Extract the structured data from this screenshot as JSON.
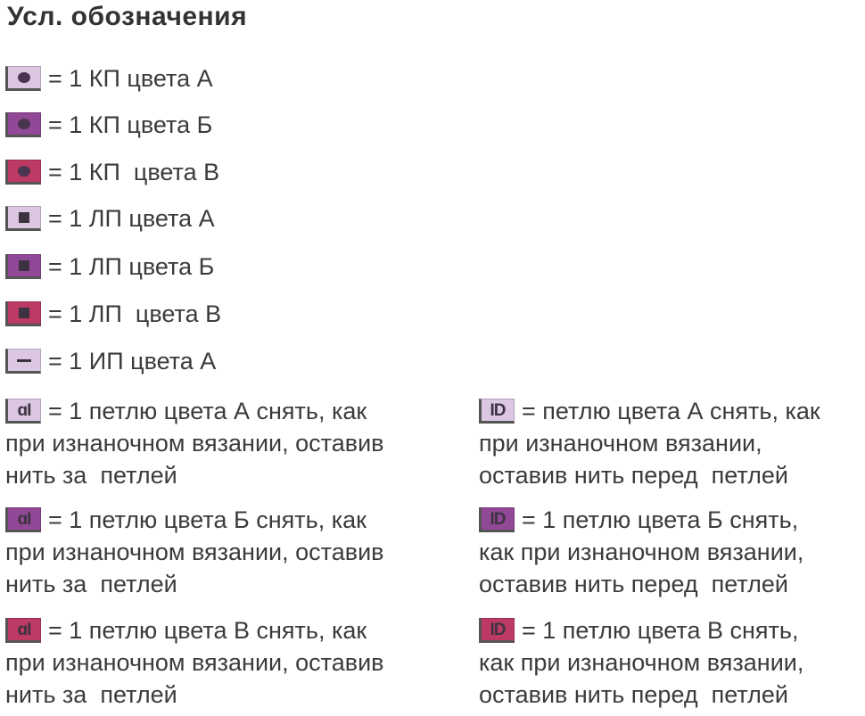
{
  "title": "Усл. обозначения",
  "colors": {
    "A": "#dcc7e3",
    "B": "#914896",
    "C": "#bd3a64"
  },
  "legend": [
    {
      "icon": "dot",
      "color": "A",
      "text": "= 1 КП цвета А"
    },
    {
      "icon": "dot",
      "color": "B",
      "text": "= 1 КП цвета Б"
    },
    {
      "icon": "dot",
      "color": "C",
      "text": "= 1 КП  цвета В"
    },
    {
      "icon": "square",
      "color": "A",
      "text": "= 1 ЛП цвета А"
    },
    {
      "icon": "square",
      "color": "B",
      "text": "= 1 ЛП цвета Б"
    },
    {
      "icon": "square",
      "color": "C",
      "text": "= 1 ЛП  цвета В"
    },
    {
      "icon": "dash",
      "color": "A",
      "text": "= 1 ИП цвета А"
    }
  ],
  "slip_back": [
    {
      "color": "A",
      "lines": [
        "= 1 петлю цвета А снять, как",
        "при изнаночном вязании, оставив",
        "нить за  петлей"
      ]
    },
    {
      "color": "B",
      "lines": [
        "= 1 петлю цвета Б снять, как",
        "при изнаночном вязании, оставив",
        "нить за  петлей"
      ]
    },
    {
      "color": "C",
      "lines": [
        "= 1 петлю цвета В снять, как",
        "при изнаночном вязании, оставив",
        "нить за  петлей"
      ]
    }
  ],
  "slip_front": [
    {
      "color": "A",
      "lines": [
        "= петлю цвета А снять, как",
        "при изнаночном вязании,",
        "оставив нить перед  петлей"
      ]
    },
    {
      "color": "B",
      "lines": [
        "= 1 петлю цвета Б снять,",
        "как при изнаночном вязании,",
        "оставив нить перед  петлей"
      ]
    },
    {
      "color": "C",
      "lines": [
        "= 1 петлю цвета В снять,",
        "как при изнаночном вязании,",
        "оставив нить перед  петлей"
      ]
    }
  ],
  "glyphs": {
    "slip_back": "ɑI",
    "slip_front": "ID"
  }
}
